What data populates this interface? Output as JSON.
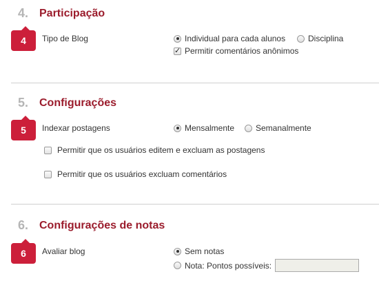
{
  "participacao": {
    "number": "4.",
    "title": "Participação",
    "badge": "4",
    "tipo_label": "Tipo de Blog",
    "radio_individual": "Individual para cada alunos",
    "radio_individual_selected": true,
    "radio_disciplina": "Disciplina",
    "radio_disciplina_selected": false,
    "check_anonimos": "Permitir comentários anônimos",
    "check_anonimos_checked": true
  },
  "configuracoes": {
    "number": "5.",
    "title": "Configurações",
    "badge": "5",
    "indexar_label": "Indexar postagens",
    "radio_mensal": "Mensalmente",
    "radio_mensal_selected": true,
    "radio_semanal": "Semanalmente",
    "radio_semanal_selected": false,
    "check_editar": "Permitir que os usuários editem e excluam as postagens",
    "check_editar_checked": false,
    "check_excluir": "Permitir que os usuários excluam comentários",
    "check_excluir_checked": false
  },
  "notas": {
    "number": "6.",
    "title": "Configurações de notas",
    "badge": "6",
    "avaliar_label": "Avaliar blog",
    "radio_sem_notas": "Sem notas",
    "radio_sem_notas_selected": true,
    "radio_nota": "Nota: Pontos possíveis:",
    "radio_nota_selected": false,
    "pontos_value": ""
  },
  "colors": {
    "accent": "#9b1c2c",
    "badge": "#cc1f3a",
    "section_number": "#b5b5b5"
  }
}
